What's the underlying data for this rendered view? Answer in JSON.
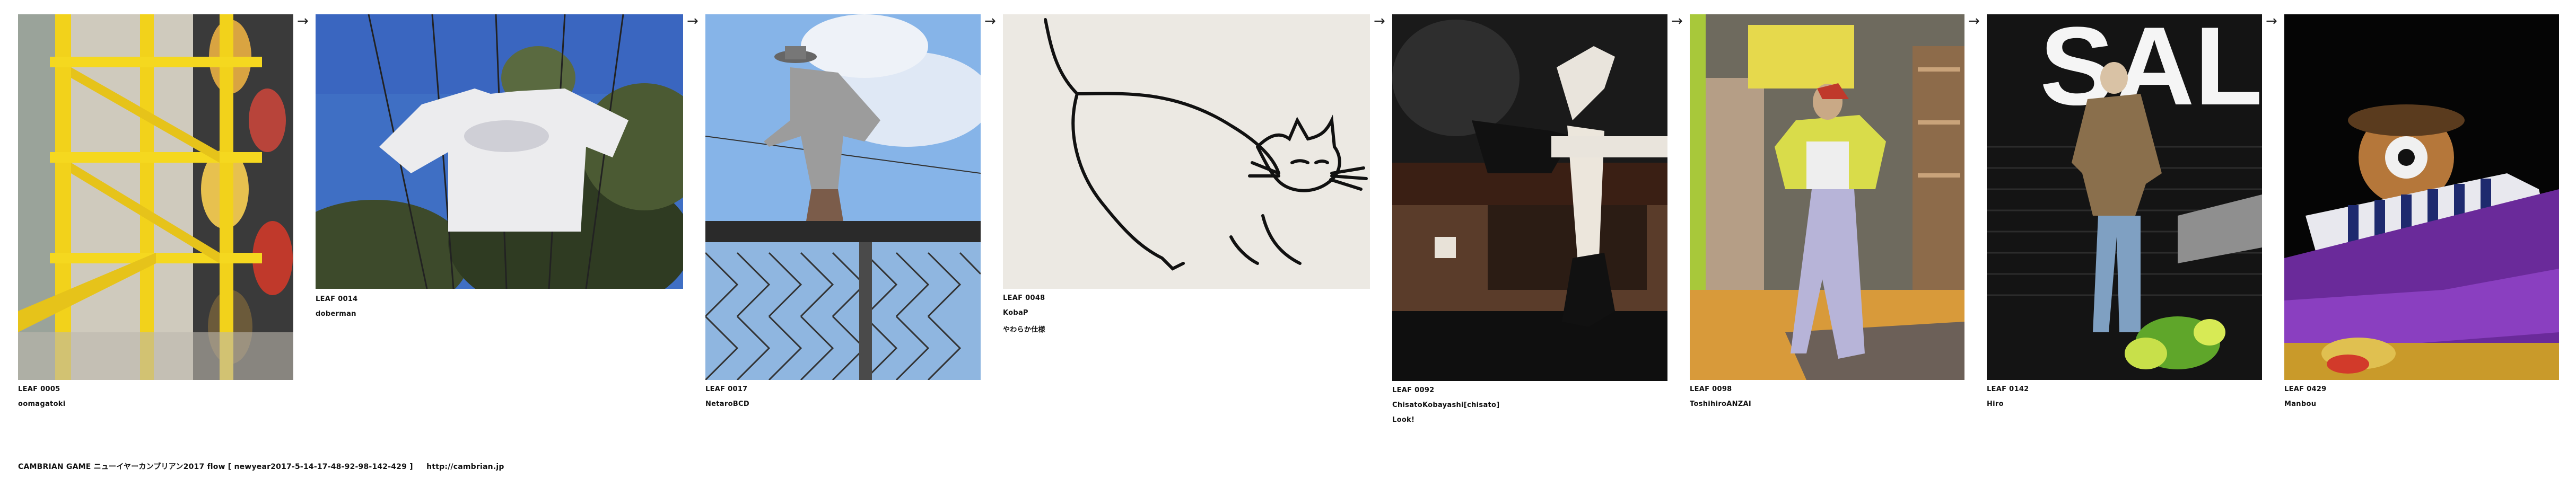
{
  "leaves": [
    {
      "id": "LEAF 0005",
      "author": "oomagatoki",
      "note": "",
      "photo": "yellow-staircase"
    },
    {
      "id": "LEAF 0014",
      "author": "doberman",
      "note": "",
      "photo": "tshirt-on-wires"
    },
    {
      "id": "LEAF 0017",
      "author": "NetarοBCD",
      "note": "",
      "photo": "figure-on-fence"
    },
    {
      "id": "LEAF 0048",
      "author": "KobaP",
      "note": "やわらか仕様",
      "photo": "cat-drawing"
    },
    {
      "id": "LEAF 0092",
      "author": "ChisatoKobayashi[chisato]",
      "note": "Look!",
      "photo": "mannequin-legs"
    },
    {
      "id": "LEAF 0098",
      "author": "ToshihiroANZAI",
      "note": "",
      "photo": "mannequin-shop"
    },
    {
      "id": "LEAF 0142",
      "author": "Hiro",
      "note": "",
      "photo": "sale-window"
    },
    {
      "id": "LEAF 0429",
      "author": "Manbou",
      "note": "",
      "photo": "festival-float"
    }
  ],
  "arrow_glyph": "→",
  "footer": {
    "text": "CAMBRIAN GAME  ニューイヤーカンブリアン2017  flow [ newyear2017-5-14-17-48-92-98-142-429 ]",
    "link": "http://cambrian.jp"
  }
}
